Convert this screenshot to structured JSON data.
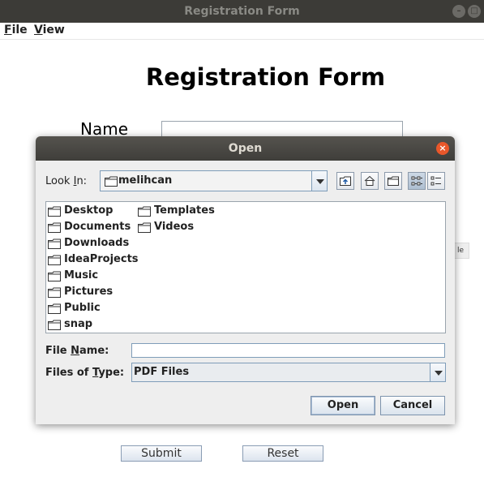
{
  "window": {
    "title": "Registration Form"
  },
  "menu": {
    "file": "File",
    "file_mnemonic": "F",
    "file_rest": "ile",
    "view": "View",
    "view_mnemonic": "V",
    "view_rest": "iew"
  },
  "form": {
    "heading": "Registration Form",
    "name_label": "Name",
    "name_value": "",
    "partial_button_text": "le",
    "submit_label": "Submit",
    "reset_label": "Reset"
  },
  "dialog": {
    "title": "Open",
    "look_in_label_pre": "Look ",
    "look_in_label_mn": "I",
    "look_in_label_post": "n:",
    "look_in_value": "melihcan",
    "toolbar_icons": [
      "up-one-level-icon",
      "home-icon",
      "new-folder-icon",
      "list-view-icon",
      "details-view-icon"
    ],
    "files": [
      "Desktop",
      "Documents",
      "Downloads",
      "IdeaProjects",
      "Music",
      "Pictures",
      "Public",
      "snap",
      "Templates",
      "Videos"
    ],
    "file_name_label_pre": "File ",
    "file_name_label_mn": "N",
    "file_name_label_post": "ame:",
    "file_name_value": "",
    "file_type_label_pre": "Files of ",
    "file_type_label_mn": "T",
    "file_type_label_post": "ype:",
    "file_type_value": "PDF Files",
    "open_label": "Open",
    "cancel_label": "Cancel"
  },
  "colors": {
    "titlebar": "#3c3b37",
    "dialog_bg": "#eeeeee",
    "close": "#e9572a",
    "border": "#7f9db9"
  }
}
